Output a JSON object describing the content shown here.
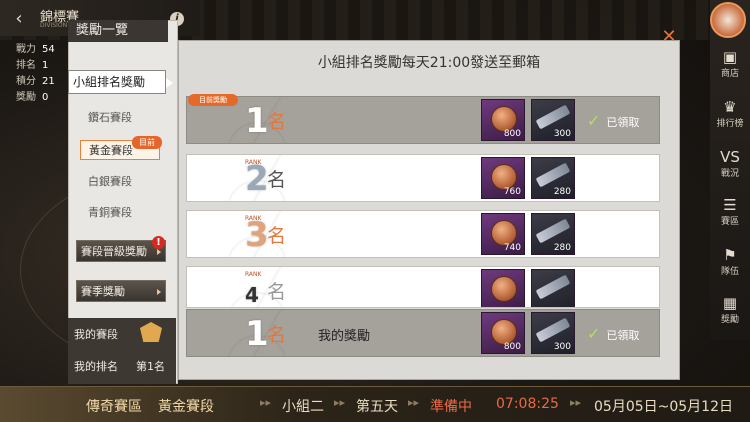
{
  "top": {
    "title": "錦標賽",
    "subtitle": "DIVISION",
    "stats": [
      {
        "label": "戰力",
        "value": "54"
      },
      {
        "label": "排名",
        "value": "1"
      },
      {
        "label": "積分",
        "value": "21"
      },
      {
        "label": "獎勵",
        "value": "0"
      }
    ]
  },
  "side_menu": [
    {
      "icon": "shop-icon",
      "glyph": "▣",
      "label": "商店"
    },
    {
      "icon": "trophy-icon",
      "glyph": "♛",
      "label": "排行榜"
    },
    {
      "icon": "vs-icon",
      "glyph": "VS",
      "label": "戰況"
    },
    {
      "icon": "rules-icon",
      "glyph": "☰",
      "label": "賽區"
    },
    {
      "icon": "team-icon",
      "glyph": "⚑",
      "label": "隊伍"
    },
    {
      "icon": "reward-icon",
      "glyph": "▦",
      "label": "獎勵"
    }
  ],
  "left_panel": {
    "header": "獎勵一覽",
    "main_tab": "小組排名獎勵",
    "tiers": [
      "鑽石賽段",
      "黃金賽段",
      "白銀賽段",
      "青銅賽段"
    ],
    "active_tier_index": 1,
    "current_badge": "目前",
    "promo_button": "賽段晉級獎勵",
    "season_button": "賽季獎勵",
    "alert_glyph": "!",
    "my_tier_label": "我的賽段",
    "my_rank_label": "我的排名",
    "my_rank_value": "第1名"
  },
  "main": {
    "title": "小組排名獎勵每天21:00發送至郵箱",
    "current_badge": "目前獎勵",
    "rank_word": "名",
    "rank_tiny": "RANK",
    "claimed_label": "已領取",
    "my_reward_label": "我的獎勵",
    "rows": [
      {
        "rank": "1",
        "coin": "800",
        "blade": "300",
        "claimed": true
      },
      {
        "rank": "2",
        "coin": "760",
        "blade": "280",
        "claimed": false
      },
      {
        "rank": "3",
        "coin": "740",
        "blade": "280",
        "claimed": false
      },
      {
        "rank": "4",
        "coin": "",
        "blade": "",
        "claimed": false
      }
    ],
    "my_row": {
      "rank": "1",
      "coin": "800",
      "blade": "300",
      "claimed": true
    }
  },
  "bottom": {
    "zone": "傳奇賽區",
    "tier": "黃金賽段",
    "group": "小組二",
    "day": "第五天",
    "status": "準備中",
    "countdown": "07:08:25",
    "dates": "05月05日~05月12日"
  },
  "colors": {
    "accent": "#e6652a",
    "claimed_check": "#b3e05a",
    "countdown": "#e05a3a"
  }
}
